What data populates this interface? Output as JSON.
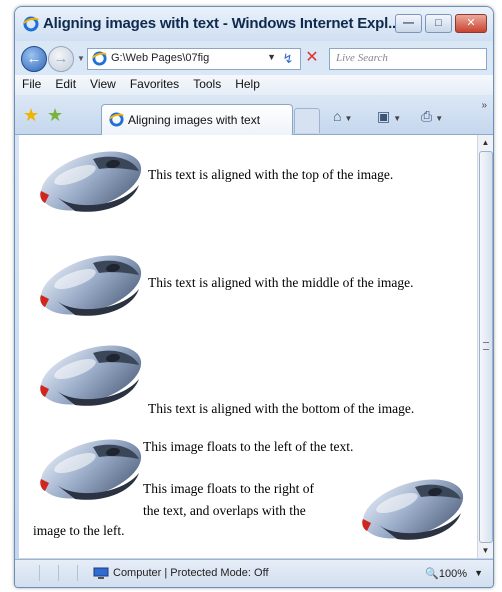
{
  "window": {
    "title": "Aligning images with text - Windows Internet Expl...",
    "minimize_glyph": "—",
    "maximize_glyph": "□",
    "close_glyph": "✕"
  },
  "addressbar": {
    "url": "G:\\Web Pages\\07fig",
    "search_placeholder": "Live Search"
  },
  "menu": [
    "File",
    "Edit",
    "View",
    "Favorites",
    "Tools",
    "Help"
  ],
  "tab": {
    "label": "Aligning images with text"
  },
  "page": {
    "text_top": "This text is aligned with the top of the image.",
    "text_middle": "This text is aligned with the middle of the image.",
    "text_bottom": "This text is aligned with the bottom of the image.",
    "float_left": "This image floats to the left of the text.",
    "float_right_line1": "This image floats to the right of",
    "float_right_line2": "the text, and overlaps with the",
    "float_right_line3": "image to the left."
  },
  "status": {
    "text": "Computer | Protected Mode: Off",
    "zoom": "100%"
  },
  "colors": {
    "frame": "#c3d6ee",
    "accent": "#2e64b5"
  },
  "icons": [
    "ie-icon",
    "back-arrow-icon",
    "forward-arrow-icon",
    "refresh-icon",
    "stop-icon",
    "favorites-star-icon",
    "add-favorites-icon",
    "home-icon",
    "feeds-icon",
    "print-icon",
    "computer-icon",
    "mouse-image"
  ]
}
